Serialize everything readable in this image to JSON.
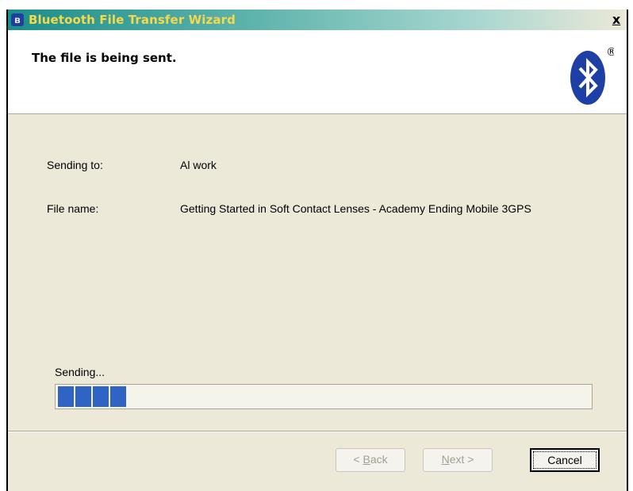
{
  "window": {
    "title": "Bluetooth File Transfer Wizard",
    "close_label": "x"
  },
  "header": {
    "heading": "The file is being sent.",
    "logo_registered": "®"
  },
  "details": {
    "sending_to_label": "Sending to:",
    "sending_to_value": "Al work",
    "file_name_label": "File name:",
    "file_name_value": "Getting Started in Soft Contact Lenses - Academy Ending Mobile 3GPS"
  },
  "progress": {
    "label": "Sending...",
    "blocks_filled": 4
  },
  "buttons": {
    "back_label": "< Back",
    "back_accel": "B",
    "next_label": "Next >",
    "next_accel": "N",
    "cancel_label": "Cancel"
  },
  "colors": {
    "progress_fill": "#2f64c4",
    "title_text": "#f7d84a",
    "logo_blue": "#1d3fa6"
  }
}
